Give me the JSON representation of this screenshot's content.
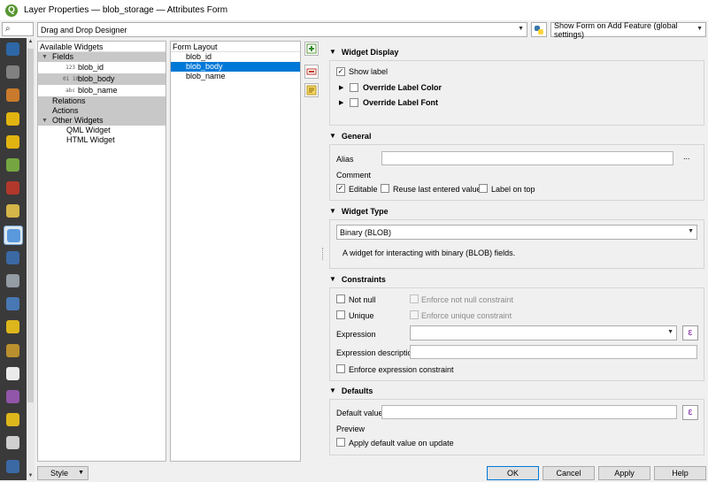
{
  "window": {
    "title": "Layer Properties — blob_storage — Attributes Form"
  },
  "search": {
    "placeholder": ""
  },
  "sidebar": {
    "items": [
      {
        "icon": "information-icon"
      },
      {
        "icon": "source-icon"
      },
      {
        "icon": "symbology-icon"
      },
      {
        "icon": "labels-icon"
      },
      {
        "icon": "mask-icon"
      },
      {
        "icon": "3d-view-icon"
      },
      {
        "icon": "diagrams-icon"
      },
      {
        "icon": "fields-icon"
      },
      {
        "icon": "attributes-form-icon",
        "selected": true
      },
      {
        "icon": "joins-icon"
      },
      {
        "icon": "auxiliary-storage-icon"
      },
      {
        "icon": "actions-icon"
      },
      {
        "icon": "display-icon"
      },
      {
        "icon": "rendering-icon"
      },
      {
        "icon": "temporal-icon"
      },
      {
        "icon": "variables-icon"
      },
      {
        "icon": "metadata-icon"
      },
      {
        "icon": "dependencies-icon"
      },
      {
        "icon": "legend-icon"
      }
    ]
  },
  "designer": {
    "mode": "Drag and Drop Designer"
  },
  "show_form": {
    "value": "Show Form on Add Feature (global settings)"
  },
  "available_widgets": {
    "header": "Available Widgets",
    "fields_label": "Fields",
    "fields": [
      {
        "type": "123",
        "name": "blob_id"
      },
      {
        "type": "01\n10",
        "name": "blob_body"
      },
      {
        "type": "abc",
        "name": "blob_name"
      }
    ],
    "relations_label": "Relations",
    "actions_label": "Actions",
    "other_label": "Other Widgets",
    "other": [
      "QML Widget",
      "HTML Widget"
    ]
  },
  "form_layout": {
    "header": "Form Layout",
    "items": [
      "blob_id",
      "blob_body",
      "blob_name"
    ],
    "selected_index": 1
  },
  "widget_display": {
    "title": "Widget Display",
    "show_label": "Show label",
    "show_label_checked": true,
    "override_color": "Override Label Color",
    "override_font": "Override Label Font"
  },
  "general": {
    "title": "General",
    "alias_label": "Alias",
    "alias_value": "",
    "more": "...",
    "comment_label": "Comment",
    "editable": "Editable",
    "editable_checked": true,
    "reuse": "Reuse last entered value",
    "label_on_top": "Label on top"
  },
  "widget_type": {
    "title": "Widget Type",
    "value": "Binary (BLOB)",
    "description": "A widget for interacting with binary (BLOB) fields."
  },
  "constraints": {
    "title": "Constraints",
    "not_null": "Not null",
    "enforce_not_null": "Enforce not null constraint",
    "unique": "Unique",
    "enforce_unique": "Enforce unique constraint",
    "expression_label": "Expression",
    "expression_value": "",
    "expr_desc_label": "Expression description",
    "expr_desc_value": "",
    "enforce_expr": "Enforce expression constraint"
  },
  "defaults": {
    "title": "Defaults",
    "default_label": "Default value",
    "default_value": "",
    "preview_label": "Preview",
    "apply_on_update": "Apply default value on update"
  },
  "footer": {
    "style": "Style",
    "ok": "OK",
    "cancel": "Cancel",
    "apply": "Apply",
    "help": "Help"
  },
  "colors": {
    "selection": "#0078d7",
    "sidebar_bg": "#3a3a3a",
    "expression_icon": "#7b1fa2"
  }
}
